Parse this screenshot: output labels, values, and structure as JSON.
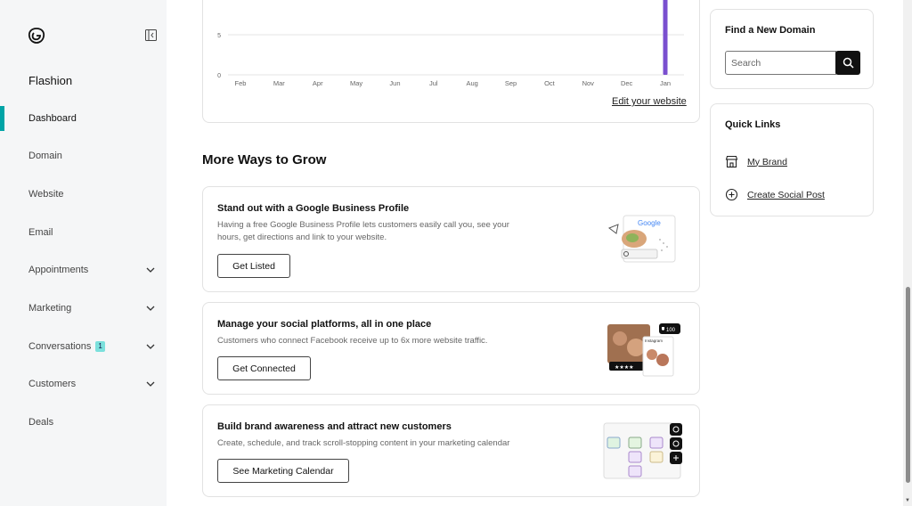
{
  "sidebar": {
    "logo_icon": "godaddy-logo-icon",
    "collapse_icon": "collapse-sidebar-icon",
    "site_name": "Flashion",
    "items": [
      {
        "label": "Dashboard",
        "active": true,
        "expandable": false
      },
      {
        "label": "Domain",
        "active": false,
        "expandable": false
      },
      {
        "label": "Website",
        "active": false,
        "expandable": false
      },
      {
        "label": "Email",
        "active": false,
        "expandable": false
      },
      {
        "label": "Appointments",
        "active": false,
        "expandable": true
      },
      {
        "label": "Marketing",
        "active": false,
        "expandable": true
      },
      {
        "label": "Conversations",
        "active": false,
        "expandable": true,
        "badge": "1"
      },
      {
        "label": "Customers",
        "active": false,
        "expandable": true
      },
      {
        "label": "Deals",
        "active": false,
        "expandable": false
      }
    ]
  },
  "chart_data": {
    "type": "bar",
    "categories": [
      "Feb",
      "Mar",
      "Apr",
      "May",
      "Jun",
      "Jul",
      "Aug",
      "Sep",
      "Oct",
      "Nov",
      "Dec",
      "Jan"
    ],
    "values": [
      0,
      0,
      0,
      0,
      0,
      0,
      0,
      0,
      0,
      0,
      0,
      10
    ],
    "y_ticks": [
      "0",
      "5"
    ],
    "ylim": [
      0,
      10
    ],
    "bar_color": "#7a4fcf",
    "grid": true
  },
  "chart_card": {
    "edit_link": "Edit your website"
  },
  "grow": {
    "title": "More Ways to Grow",
    "cards": [
      {
        "title": "Stand out with a Google Business Profile",
        "text": "Having a free Google Business Profile lets customers easily call you, see your hours, get directions and link to your website.",
        "button": "Get Listed",
        "art_label": "Google"
      },
      {
        "title": "Manage your social platforms, all in one place",
        "text": "Customers who connect Facebook receive up to 6x more website traffic.",
        "button": "Get Connected",
        "art_label": "Instagram",
        "art_count": "100"
      },
      {
        "title": "Build brand awareness and attract new customers",
        "text": "Create, schedule, and track scroll-stopping content in your marketing calendar",
        "button": "See Marketing Calendar"
      }
    ]
  },
  "find_domain": {
    "title": "Find a New Domain",
    "placeholder": "Search",
    "search_icon": "search-icon"
  },
  "quick_links": {
    "title": "Quick Links",
    "items": [
      {
        "label": "My Brand",
        "icon": "storefront-icon"
      },
      {
        "label": "Create Social Post",
        "icon": "plus-circle-icon"
      }
    ]
  },
  "colors": {
    "accent": "#00a4a6",
    "bar": "#7a4fcf",
    "sidebar_bg": "#f5f6f7"
  }
}
